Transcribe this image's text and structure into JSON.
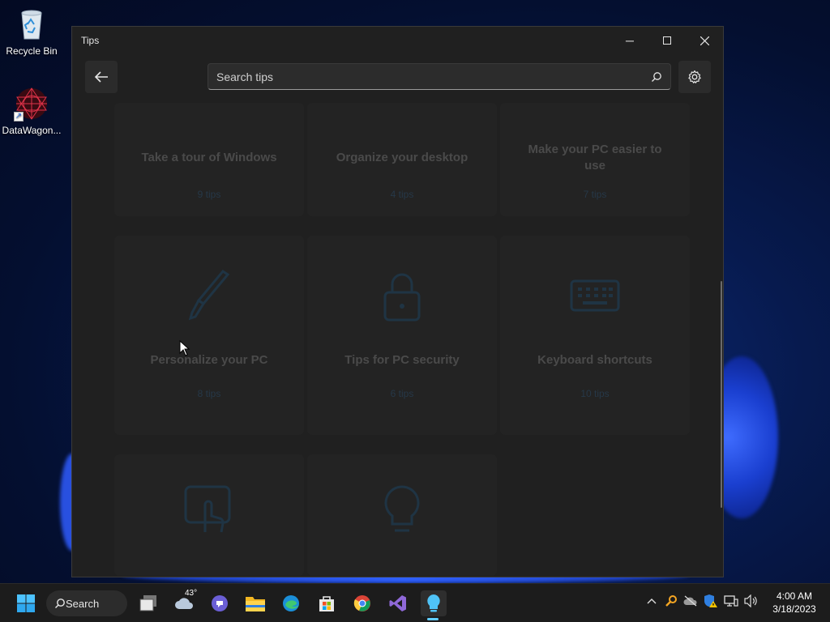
{
  "desktop": {
    "icons": [
      {
        "label": "Recycle Bin"
      },
      {
        "label": "DataWagon..."
      }
    ]
  },
  "window": {
    "title": "Tips",
    "search": {
      "placeholder": "Search tips",
      "value": ""
    },
    "cards": [
      {
        "title": "Take a tour of Windows",
        "count": "9 tips"
      },
      {
        "title": "Organize your desktop",
        "count": "4 tips"
      },
      {
        "title": "Make your PC easier to use",
        "count": "7 tips"
      },
      {
        "title": "Personalize your PC",
        "count": "8 tips",
        "icon": "pen-icon"
      },
      {
        "title": "Tips for PC security",
        "count": "6 tips",
        "icon": "lock-icon"
      },
      {
        "title": "Keyboard shortcuts",
        "count": "10 tips",
        "icon": "keyboard-icon"
      },
      {
        "title": "",
        "count": "",
        "icon": "touch-icon"
      },
      {
        "title": "",
        "count": "",
        "icon": "lightbulb-icon"
      }
    ]
  },
  "taskbar": {
    "search_label": "Search",
    "weather_temp": "43°",
    "clock": {
      "time": "4:00 AM",
      "date": "3/18/2023"
    }
  },
  "colors": {
    "window_bg": "#202020",
    "card_bg": "#232323",
    "accent": "#60cdff",
    "taskbar_bg": "#1c1c1c"
  }
}
